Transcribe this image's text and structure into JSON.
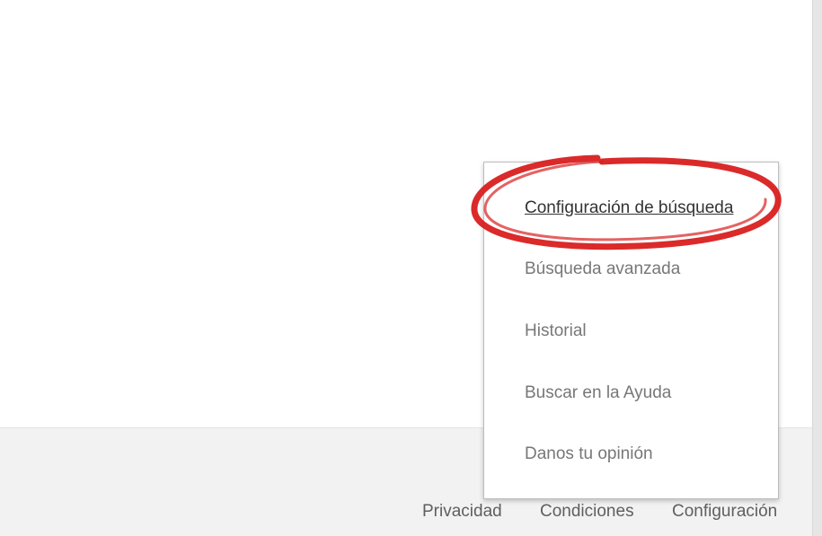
{
  "settings_menu": {
    "items": [
      {
        "label": "Configuración de búsqueda",
        "active": true
      },
      {
        "label": "Búsqueda avanzada",
        "active": false
      },
      {
        "label": "Historial",
        "active": false
      },
      {
        "label": "Buscar en la Ayuda",
        "active": false
      },
      {
        "label": "Danos tu opinión",
        "active": false
      }
    ]
  },
  "footer": {
    "links": [
      {
        "label": "Privacidad"
      },
      {
        "label": "Condiciones"
      },
      {
        "label": "Configuración"
      }
    ]
  },
  "annotation": {
    "ring_color": "#d91f1f",
    "target": "Configuración de búsqueda"
  }
}
